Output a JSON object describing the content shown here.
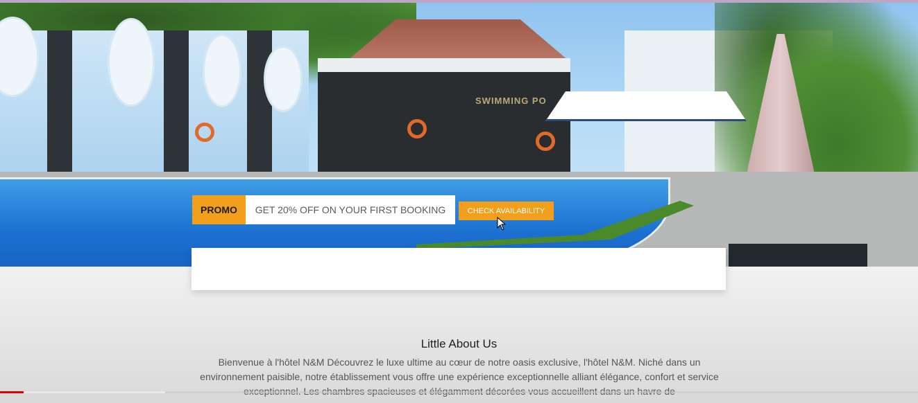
{
  "hero": {
    "sign_text": "SWIMMING PO"
  },
  "promo": {
    "label": "PROMO",
    "text": "GET 20% OFF ON YOUR FIRST BOOKING",
    "button": "CHECK AVAILABILITY"
  },
  "about": {
    "title": "Little About Us",
    "body": "Bienvenue à l'hôtel N&M Découvrez le luxe ultime au cœur de notre oasis exclusive, l'hôtel N&M. Niché dans un environnement paisible, notre établissement vous offre une expérience exceptionnelle alliant élégance, confort et service exceptionnel. Les chambres spacieuses et élégamment décorées vous accueillent dans un havre de"
  },
  "video": {
    "played_fraction": 0.026,
    "loaded_fraction": 0.18
  },
  "colors": {
    "accent": "#f2a01b",
    "progress": "#e00000"
  }
}
